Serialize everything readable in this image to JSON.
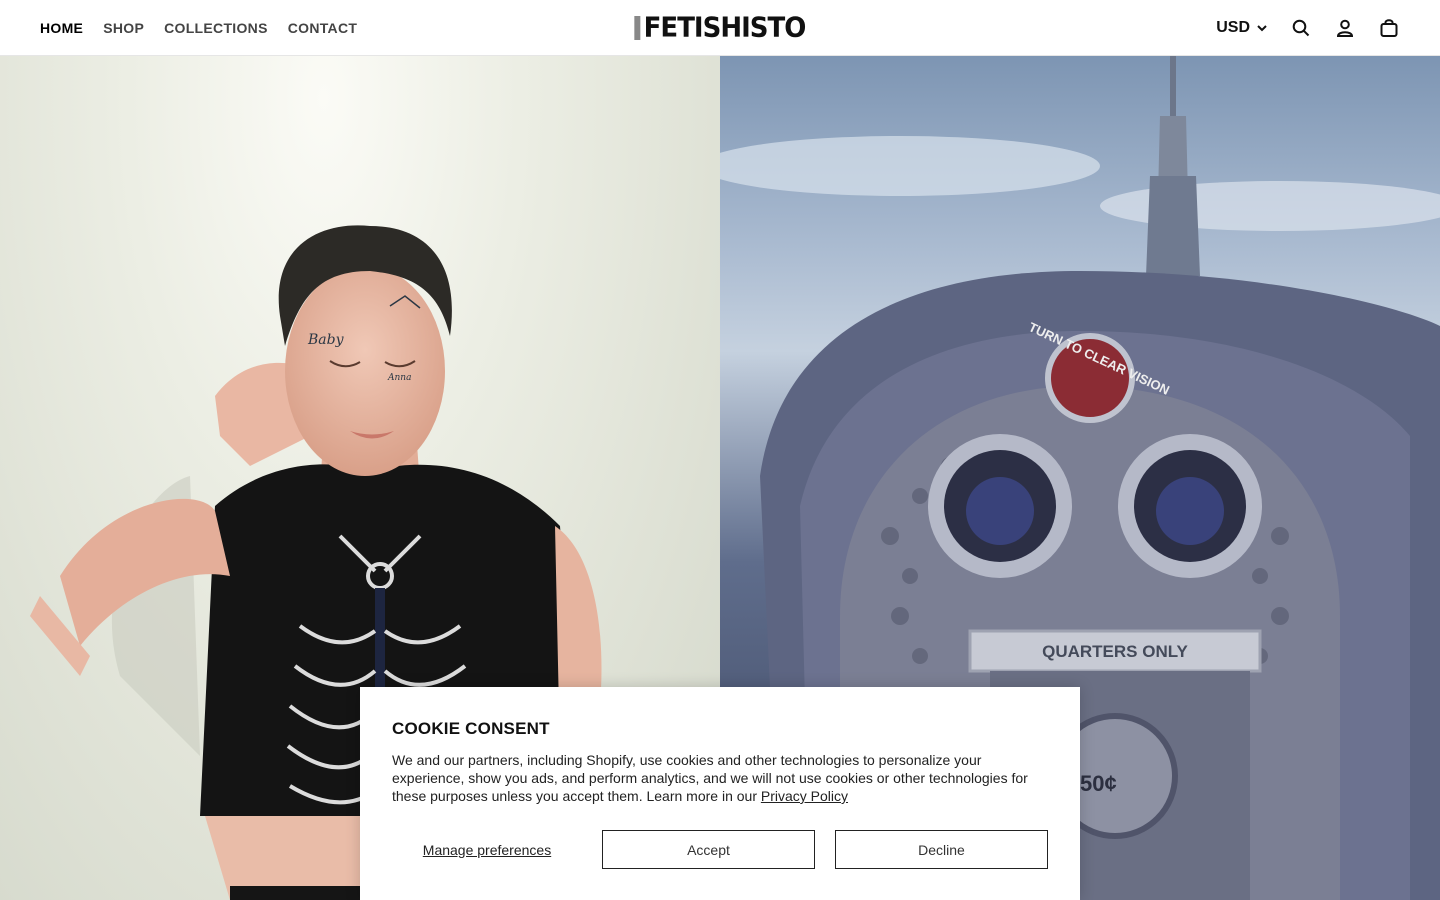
{
  "header": {
    "nav": [
      {
        "label": "HOME",
        "active": true
      },
      {
        "label": "SHOP",
        "active": false
      },
      {
        "label": "COLLECTIONS",
        "active": false
      },
      {
        "label": "CONTACT",
        "active": false
      }
    ],
    "logo": "FETISHISTO",
    "currency": "USD",
    "icons": [
      "chevron-down-icon",
      "search-icon",
      "account-icon",
      "cart-icon"
    ]
  },
  "hero": {
    "left_image": "Man with face tattoos wearing a black sleeveless crop top with a silver chain harness",
    "right_image": "Coin-operated tower viewer binoculars reading TURN TO CLEAR VISION and QUARTERS ONLY with a city spire behind",
    "right_image_texts": [
      "TURN TO CLEAR VISION",
      "QUARTERS ONLY",
      "50¢"
    ]
  },
  "cookie": {
    "title": "COOKIE CONSENT",
    "text": "We and our partners, including Shopify, use cookies and other technologies to personalize your experience, show you ads, and perform analytics, and we will not use cookies or other technologies for these purposes unless you accept them. Learn more in our ",
    "link": "Privacy Policy",
    "manage": "Manage preferences",
    "accept": "Accept",
    "decline": "Decline"
  },
  "colors": {
    "accent": "#111111",
    "background": "#ffffff",
    "border": "#222222"
  }
}
